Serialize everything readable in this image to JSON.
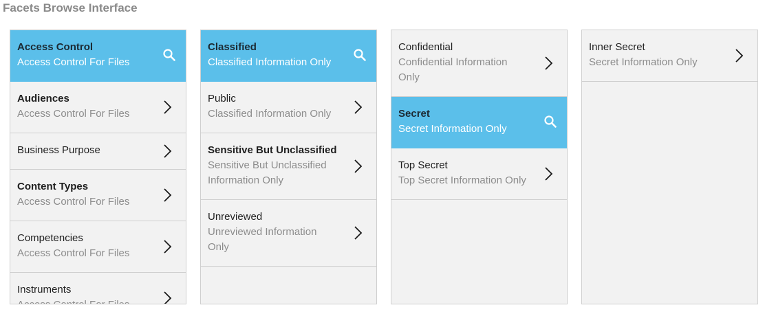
{
  "page": {
    "title": "Facets Browse Interface"
  },
  "columns": [
    {
      "items": [
        {
          "title": "Access Control",
          "subtitle": "Access Control For Files",
          "selected": true,
          "icon": "search-icon"
        },
        {
          "title": "Audiences",
          "subtitle": "Access Control For Files",
          "bold": true,
          "icon": "chevron-right-icon"
        },
        {
          "title": "Business Purpose",
          "icon": "chevron-right-icon"
        },
        {
          "title": "Content Types",
          "subtitle": "Access Control For Files",
          "bold": true,
          "icon": "chevron-right-icon"
        },
        {
          "title": "Competencies",
          "subtitle": "Access Control For Files",
          "icon": "chevron-right-icon"
        },
        {
          "title": "Instruments",
          "subtitle": "Access Control For Files",
          "icon": "chevron-right-icon"
        }
      ]
    },
    {
      "items": [
        {
          "title": "Classified",
          "subtitle": "Classified Information Only",
          "selected": true,
          "icon": "search-icon"
        },
        {
          "title": "Public",
          "subtitle": "Classified Information Only",
          "icon": "chevron-right-icon"
        },
        {
          "title": "Sensitive But Unclassified",
          "subtitle": "Sensitive But Unclassified Information Only",
          "bold": true,
          "icon": "chevron-right-icon"
        },
        {
          "title": "Unreviewed",
          "subtitle": "Unreviewed Information Only",
          "icon": "chevron-right-icon"
        }
      ]
    },
    {
      "items": [
        {
          "title": "Confidential",
          "subtitle": "Confidential Information Only",
          "icon": "chevron-right-icon"
        },
        {
          "title": "Secret",
          "subtitle": "Secret Information Only",
          "selected": true,
          "icon": "search-icon"
        },
        {
          "title": "Top Secret",
          "subtitle": "Top Secret Information Only",
          "icon": "chevron-right-icon"
        }
      ]
    },
    {
      "items": [
        {
          "title": "Inner Secret",
          "subtitle": "Secret Information Only",
          "icon": "chevron-right-icon"
        }
      ]
    }
  ]
}
